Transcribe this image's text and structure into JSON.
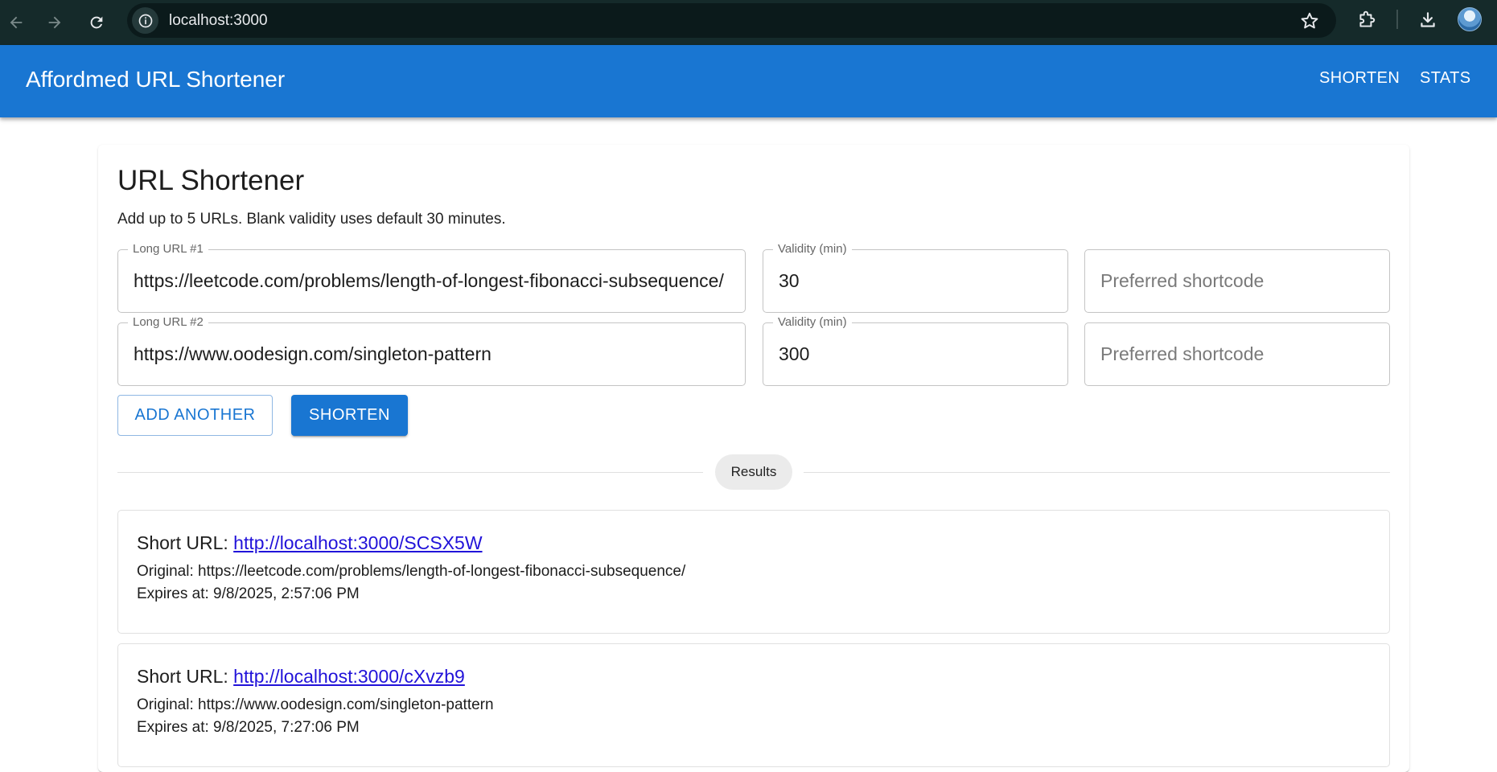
{
  "browser": {
    "url": "localhost:3000"
  },
  "app": {
    "title": "Affordmed URL Shortener",
    "nav": [
      "SHORTEN",
      "STATS"
    ],
    "accent_color": "#1976d2"
  },
  "form": {
    "title": "URL Shortener",
    "subtitle": "Add up to 5 URLs. Blank validity uses default 30 minutes.",
    "rows": [
      {
        "url_label": "Long URL #1",
        "url_value": "https://leetcode.com/problems/length-of-longest-fibonacci-subsequence/",
        "validity_label": "Validity (min)",
        "validity_value": "30",
        "shortcode_placeholder": "Preferred shortcode"
      },
      {
        "url_label": "Long URL #2",
        "url_value": "https://www.oodesign.com/singleton-pattern",
        "validity_label": "Validity (min)",
        "validity_value": "300",
        "shortcode_placeholder": "Preferred shortcode"
      }
    ],
    "add_button": "ADD ANOTHER",
    "shorten_button": "SHORTEN"
  },
  "results": {
    "chip_label": "Results",
    "items": [
      {
        "short_prefix": "Short URL: ",
        "short_url": "http://localhost:3000/SCSX5W",
        "original": "Original: https://leetcode.com/problems/length-of-longest-fibonacci-subsequence/",
        "expires": "Expires at: 9/8/2025, 2:57:06 PM"
      },
      {
        "short_prefix": "Short URL: ",
        "short_url": "http://localhost:3000/cXvzb9",
        "original": "Original: https://www.oodesign.com/singleton-pattern",
        "expires": "Expires at: 9/8/2025, 7:27:06 PM"
      }
    ]
  }
}
